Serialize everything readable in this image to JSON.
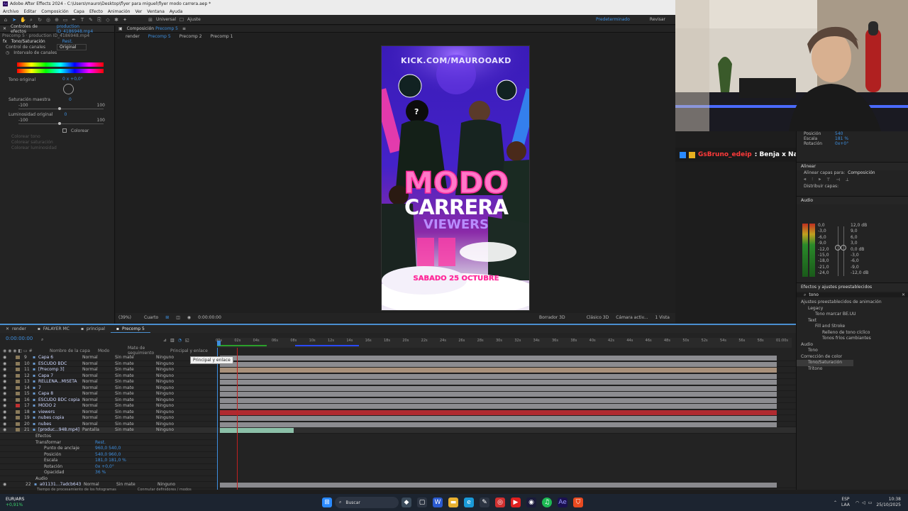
{
  "app": {
    "title": "Adobe After Effects 2024 - C:\\Users\\mauro\\Desktop\\flyer para miguel\\flyer modo carrera.aep *",
    "menu": [
      "Archivo",
      "Editar",
      "Composición",
      "Capa",
      "Efecto",
      "Animación",
      "Ver",
      "Ventana",
      "Ayuda"
    ]
  },
  "toolbar": {
    "universal": "Universal",
    "ajuste": "Ajuste",
    "workspace": "Predeterminado",
    "revisar": "Revisar"
  },
  "effects_panel": {
    "tab_label": "Controles de efectos",
    "tab_source": "production ID_4186948.mp4",
    "breadcrumb": "Precomp 5 · production ID_4186948.mp4",
    "effect_name": "Tono/Saturación",
    "reset": "Rest.",
    "canal_label": "Control de canales",
    "canal_value": "Original",
    "intervalo": "Intervalo de canales",
    "tono_label": "Tono original",
    "tono_value": "0 x +0,0°",
    "sat_label": "Saturación maestra",
    "sat_value": "0",
    "min": "-100",
    "max": "100",
    "lum_label": "Luminosidad original",
    "lum_value": "0",
    "colorear": "Colorear",
    "dim1": "Colorear tono",
    "dim2": "Colorear saturación",
    "dim3": "Colorear luminosidad"
  },
  "comp_panel": {
    "tab_prefix": "Composición",
    "tab_name": "Precomp 5",
    "crumbs": [
      "render",
      "Precomp 5",
      "Precomp 2",
      "Precomp 1"
    ],
    "zoom": "(39%)",
    "quality": "Cuarto",
    "timecode": "0:00:00:00",
    "borrador": "Borrador 3D",
    "renderer": "Clásico 3D",
    "camera": "Cámara activ...",
    "views": "1 Vista"
  },
  "flyer": {
    "url": "KICK.COM/MAUROOAKD",
    "title1": "MODO",
    "title2": "CARRERA",
    "subtitle": "VIEWERS",
    "date": "SABADO 25 OCTUBRE",
    "question": "?"
  },
  "chat": {
    "user": "GsBruno_edeip",
    "message": ": Benja x Nacho aura"
  },
  "right_panel": {
    "pos_label": "Posición",
    "pos_value": "540",
    "scale_label": "Escala",
    "scale_value": "181 %",
    "rot_label": "Rotación",
    "rot_value": "0x+0°",
    "align_title": "Alinear",
    "align_to_label": "Alinear capas para:",
    "align_to_value": "Composición",
    "distribute": "Distribuir capas:",
    "audio_title": "Audio",
    "audio_levels": [
      "0,0",
      "-3,0",
      "-6,0",
      "-9,0",
      "-12,0",
      "-15,0",
      "-18,0",
      "-21,0",
      "-24,0"
    ],
    "audio_right": [
      "12,0 dB",
      "9,0",
      "6,0",
      "3,0",
      "0,0 dB",
      "-3,0",
      "-6,0",
      "-9,0",
      "-12,0 dB"
    ],
    "fx_title": "Efectos y ajustes preestablecidos",
    "search": "tono",
    "tree": [
      "Ajustes preestablecidos de animación",
      "Legacy",
      "Tono marcar BE.UU",
      "Text",
      "Fill and Stroke",
      "Relleno de tono cíclico",
      "Tonos fríos cambiantes",
      "Audio",
      "Tono",
      "Corrección de color",
      "Tono/Saturación",
      "Tritono"
    ]
  },
  "timeline": {
    "tabs": [
      "render",
      "FALAYER MC",
      "principal",
      "Precomp 5"
    ],
    "timecode": "0:00:00:00",
    "col_name": "Nombre de la capa",
    "col_mode": "Modo",
    "col_matte": "Mate de seguimiento",
    "col_parent": "Principal y enlace",
    "tooltip": "Principal y enlace",
    "ruler": [
      "00s",
      "02s",
      "04s",
      "06s",
      "08s",
      "10s",
      "12s",
      "14s",
      "16s",
      "18s",
      "20s",
      "22s",
      "24s",
      "26s",
      "28s",
      "30s",
      "32s",
      "34s",
      "36s",
      "38s",
      "40s",
      "42s",
      "44s",
      "46s",
      "48s",
      "50s",
      "52s",
      "54s",
      "56s",
      "58s",
      "01:00s"
    ],
    "layers": [
      {
        "num": "9",
        "name": "Capa 6",
        "mode": "Normal",
        "matte": "Sin mate",
        "parent": "Ninguno"
      },
      {
        "num": "10",
        "name": "ESCUDO BDC",
        "mode": "Normal",
        "matte": "Sin mate",
        "parent": "Ninguno"
      },
      {
        "num": "11",
        "name": "[Precomp 3]",
        "mode": "Normal",
        "matte": "Sin mate",
        "parent": "Ninguno"
      },
      {
        "num": "12",
        "name": "Capa 7",
        "mode": "Normal",
        "matte": "Sin mate",
        "parent": "Ninguno"
      },
      {
        "num": "13",
        "name": "RELLENA...MISETA",
        "mode": "Normal",
        "matte": "Sin mate",
        "parent": "Ninguno"
      },
      {
        "num": "14",
        "name": "7",
        "mode": "Normal",
        "matte": "Sin mate",
        "parent": "Ninguno"
      },
      {
        "num": "15",
        "name": "Capa 8",
        "mode": "Normal",
        "matte": "Sin mate",
        "parent": "Ninguno"
      },
      {
        "num": "16",
        "name": "ESCUDO BDC copia",
        "mode": "Normal",
        "matte": "Sin mate",
        "parent": "Ninguno"
      },
      {
        "num": "17",
        "name": "MODO 2",
        "mode": "Normal",
        "matte": "Sin mate",
        "parent": "Ninguno"
      },
      {
        "num": "18",
        "name": "viewers",
        "mode": "Normal",
        "matte": "Sin mate",
        "parent": "Ninguno"
      },
      {
        "num": "19",
        "name": "nubes copia",
        "mode": "Normal",
        "matte": "Sin mate",
        "parent": "Ninguno"
      },
      {
        "num": "20",
        "name": "nubes",
        "mode": "Normal",
        "matte": "Sin mate",
        "parent": "Ninguno"
      },
      {
        "num": "21",
        "name": "[produc...948.mp4]",
        "mode": "Pantalla",
        "matte": "Sin mate",
        "parent": "Ninguno"
      }
    ],
    "props": [
      {
        "label": "Efectos",
        "value": ""
      },
      {
        "label": "Transformar",
        "value": "Rest."
      },
      {
        "label": "Punto de anclaje",
        "value": "960,0 540,0"
      },
      {
        "label": "Posición",
        "value": "540,0 960,0"
      },
      {
        "label": "Escala",
        "value": "181,0 181,0 %"
      },
      {
        "label": "Rotación",
        "value": "0x +0,0°"
      },
      {
        "label": "Opacidad",
        "value": "36 %"
      },
      {
        "label": "Audio",
        "value": ""
      }
    ],
    "last_layer": {
      "num": "22",
      "name": "a01131...7adcb643",
      "mode": "Normal",
      "matte": "Sin mate",
      "parent": "Ninguno"
    },
    "footer_left": "Tiempo de procesamiento de los fotogramas",
    "footer_mid": "Conmutar definidores / modos"
  },
  "taskbar": {
    "ticker": "EUR/ARS",
    "change": "+0,91%",
    "search": "Buscar",
    "lang1": "ESP",
    "lang2": "LAA",
    "time": "10:38",
    "date": "25/10/2025"
  },
  "colors": {
    "accent": "#3d8fe0",
    "flyer_pink": "#ff3fa8",
    "flyer_purple": "#5a22d8"
  }
}
